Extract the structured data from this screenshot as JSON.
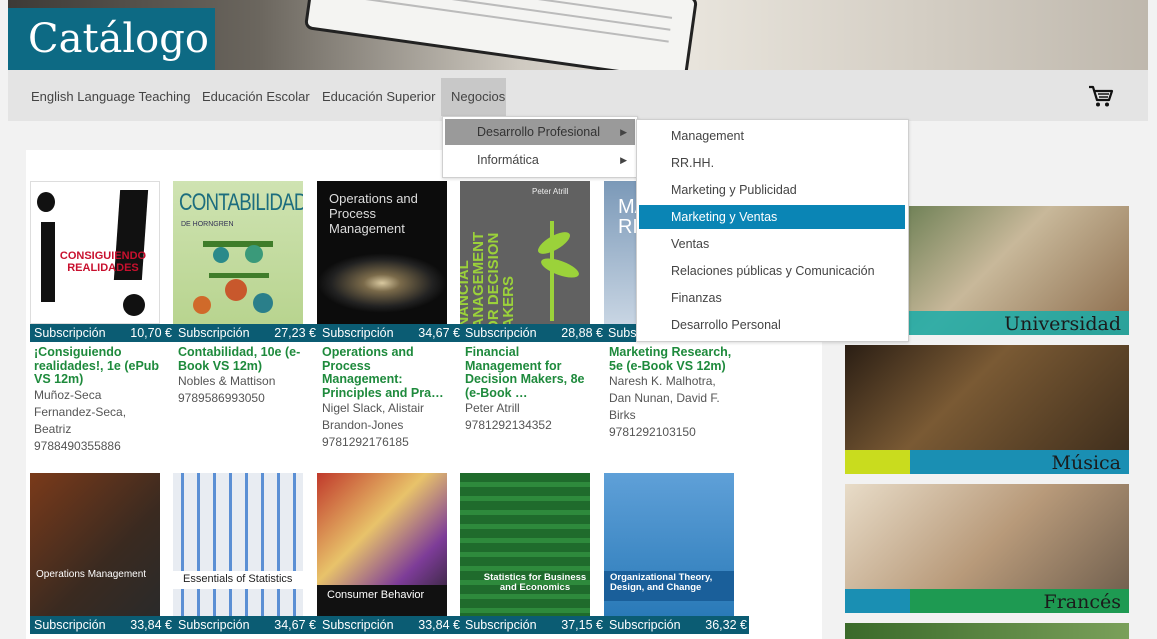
{
  "header": {
    "logo": "Catálogo"
  },
  "nav": {
    "items": [
      "English Language Teaching",
      "Educación Escolar",
      "Educación Superior",
      "Negocios"
    ],
    "active": "Negocios"
  },
  "submenu1": {
    "items": [
      {
        "label": "Desarrollo Profesional",
        "arrow": "▶"
      },
      {
        "label": "Informática",
        "arrow": "▶"
      }
    ]
  },
  "submenu2": {
    "items": [
      "Management",
      "RR.HH.",
      "Marketing y Publicidad",
      "Marketing y Ventas",
      "Ventas",
      "Relaciones públicas y Comunicación",
      "Finanzas",
      "Desarrollo Personal"
    ],
    "highlighted": "Marketing y Ventas"
  },
  "books_row1": [
    {
      "sub": "Subscripción",
      "price": "10,70 €",
      "title": "¡Consiguiendo realidades!, 1e (ePub VS 12m)",
      "authors": "Muñoz-Seca Fernandez-Seca, Beatriz",
      "isbn": "9788490355886",
      "cover_text": "CONSIGUIENDO REALIDADES"
    },
    {
      "sub": "Subscripción",
      "price": "27,23 €",
      "title": "Contabilidad, 10e (e-Book VS 12m)",
      "authors": "Nobles & Mattison",
      "isbn": "9789586993050",
      "cover_text": "CONTABILIDAD",
      "cover_sub": "DE HORNGREN"
    },
    {
      "sub": "Subscripción",
      "price": "34,67 €",
      "title": "Operations and Process Management: Principles and Pra…",
      "authors": "Nigel Slack, Alistair Brandon-Jones",
      "isbn": "9781292176185",
      "cover_text": "Operations and Process Management"
    },
    {
      "sub": "Subscripción",
      "price": "28,88 €",
      "title": "Financial Management for Decision Makers, 8e (e-Book …",
      "authors": "Peter Atrill",
      "isbn": "9781292134352",
      "cover_text": "FINANCIAL MANAGEMENT FOR DECISION MAKERS",
      "cover_sub": "Peter Atrill"
    },
    {
      "sub": "Subs",
      "price": "",
      "title": "Marketing Research, 5e (e-Book VS 12m)",
      "authors": "Naresh K. Malhotra, Dan Nunan, David F. Birks",
      "isbn": "9781292103150",
      "cover_text": "MA RE"
    }
  ],
  "books_row2": [
    {
      "sub": "Subscripción",
      "price": "33,84 €",
      "cover_text": "Operations Management"
    },
    {
      "sub": "Subscripción",
      "price": "34,67 €",
      "cover_text": "Essentials of Statistics"
    },
    {
      "sub": "Subscripción",
      "price": "33,84 €",
      "cover_text": "Consumer Behavior"
    },
    {
      "sub": "Subscripción",
      "price": "37,15 €",
      "cover_text": "Statistics for Business and Economics"
    },
    {
      "sub": "Subscripción",
      "price": "36,32 €",
      "cover_text": "Organizational Theory, Design, and Change"
    }
  ],
  "side_banners": [
    "Universidad",
    "Música",
    "Francés"
  ],
  "colors": {
    "brand": "#0d6a84",
    "price_bar": "#0b5c73",
    "title_green": "#1e8a3c",
    "menu_highlight": "#0a85b5"
  },
  "icons": {
    "cart": "cart-icon",
    "submenu_arrow": "arrow-right-icon"
  }
}
